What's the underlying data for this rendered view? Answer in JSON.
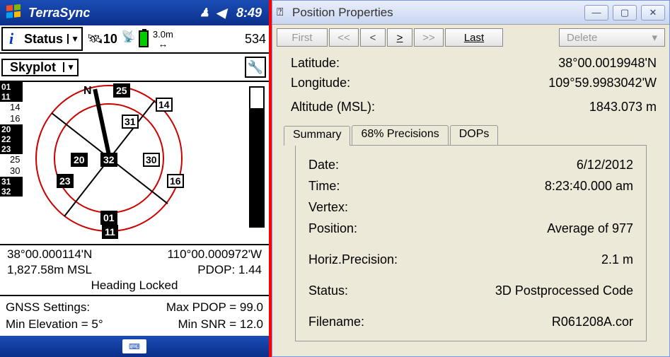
{
  "pda": {
    "title": "TerraSync",
    "clock": "8:49",
    "status_label": "Status",
    "skyplot_label": "Skyplot",
    "sat_count": "10",
    "distance": "3.0m",
    "row1_right": "534",
    "left_bars": {
      "b1": "01",
      "b2": "11",
      "w1": "14",
      "w2": "16",
      "b3": "20",
      "b4": "22",
      "b5": "23",
      "w3": "25",
      "w4": "30",
      "b6": "31",
      "b7": "32"
    },
    "sats": {
      "s25": "25",
      "s14": "14",
      "s31": "31",
      "s20": "20",
      "s32": "32",
      "s30": "30",
      "s23": "23",
      "s16": "16",
      "s01": "01",
      "s11": "11"
    },
    "north": "N",
    "lat": "38°00.000114'N",
    "lon": "110°00.000972'W",
    "alt": "1,827.58m MSL",
    "pdop": "PDOP: 1.44",
    "heading": "Heading Locked",
    "settings_label": "GNSS Settings:",
    "max_pdop": "Max PDOP = 99.0",
    "min_elev": "Min Elevation = 5°",
    "min_snr": "Min SNR = 12.0"
  },
  "win": {
    "title": "Position Properties",
    "nav": {
      "first": "First",
      "prev2": "<<",
      "prev": "<",
      "next": ">",
      "next2": ">>",
      "last": "Last",
      "delete": "Delete"
    },
    "coords": {
      "lat_label": "Latitude:",
      "lat_val": "38°00.0019948'N",
      "lon_label": "Longitude:",
      "lon_val": "109°59.9983042'W",
      "alt_label": "Altitude (MSL):",
      "alt_val": "1843.073 m"
    },
    "tabs": {
      "summary": "Summary",
      "prec": "68% Precisions",
      "dops": "DOPs"
    },
    "summary": {
      "date_label": "Date:",
      "date_val": "6/12/2012",
      "time_label": "Time:",
      "time_val": "8:23:40.000 am",
      "vertex_label": "Vertex:",
      "vertex_val": "",
      "pos_label": "Position:",
      "pos_val": "Average of 977",
      "hprec_label": "Horiz.Precision:",
      "hprec_val": "2.1 m",
      "status_label": "Status:",
      "status_val": "3D Postprocessed Code",
      "file_label": "Filename:",
      "file_val": "R061208A.cor"
    }
  }
}
